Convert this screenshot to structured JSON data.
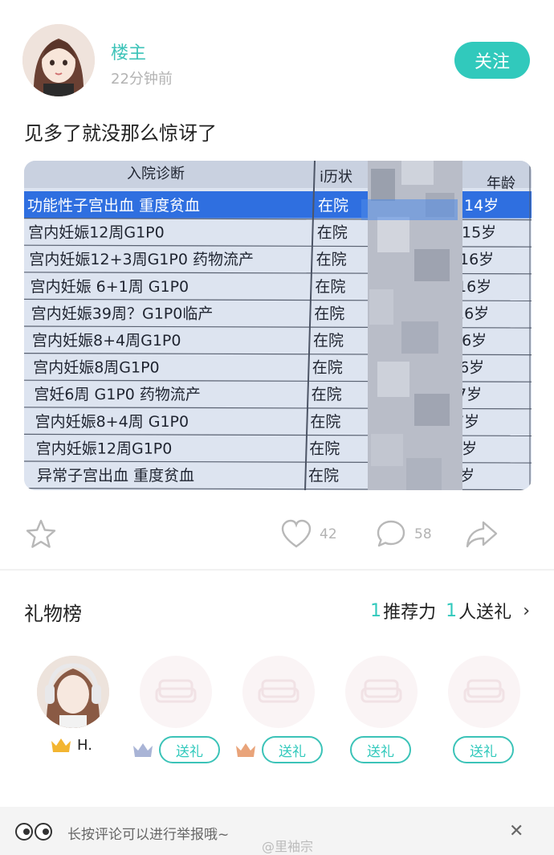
{
  "post": {
    "author": "楼主",
    "time": "22分钟前",
    "follow_label": "关注",
    "text": "见多了就没那么惊讶了"
  },
  "photo": {
    "headers": {
      "diagnosis": "入院诊断",
      "status": "i历状",
      "age": "年龄"
    },
    "rows": [
      {
        "diagnosis": "功能性子宫出血  重度贫血",
        "status": "在院",
        "age": "14岁"
      },
      {
        "diagnosis": "宫内妊娠12周G1P0",
        "status": "在院",
        "age": "15岁"
      },
      {
        "diagnosis": "宫内妊娠12+3周G1P0 药物流产",
        "status": "在院",
        "age": "16岁"
      },
      {
        "diagnosis": "宫内妊娠 6+1周 G1P0",
        "status": "在院",
        "age": "16岁"
      },
      {
        "diagnosis": "宫内妊娠39周？G1P0临产",
        "status": "在院",
        "age": "16岁"
      },
      {
        "diagnosis": "宫内妊娠8+4周G1P0",
        "status": "在院",
        "age": "16岁"
      },
      {
        "diagnosis": "宫内妊娠8周G1P0",
        "status": "在院",
        "age": "16岁"
      },
      {
        "diagnosis": "宫妊6周 G1P0 药物流产",
        "status": "在院",
        "age": "17岁"
      },
      {
        "diagnosis": "宫内妊娠8+4周 G1P0",
        "status": "在院",
        "age": "17岁"
      },
      {
        "diagnosis": "宫内妊娠12周G1P0",
        "status": "在院",
        "age": "17岁"
      },
      {
        "diagnosis": "异常子宫出血 重度贫血",
        "status": "在院",
        "age": "17岁"
      }
    ]
  },
  "actions": {
    "likes": "42",
    "comments": "58"
  },
  "gifts": {
    "title": "礼物榜",
    "recommend_count": "1",
    "recommend_label": "推荐力",
    "giver_count": "1",
    "giver_label": "人送礼",
    "first_name": "H.",
    "send_label": "送礼"
  },
  "bottom": {
    "hint": "长按评论可以进行举报哦~",
    "watermark": "@里袖宗"
  },
  "colors": {
    "accent": "#31c9bc",
    "highlight_row": "#2f6fe0"
  }
}
